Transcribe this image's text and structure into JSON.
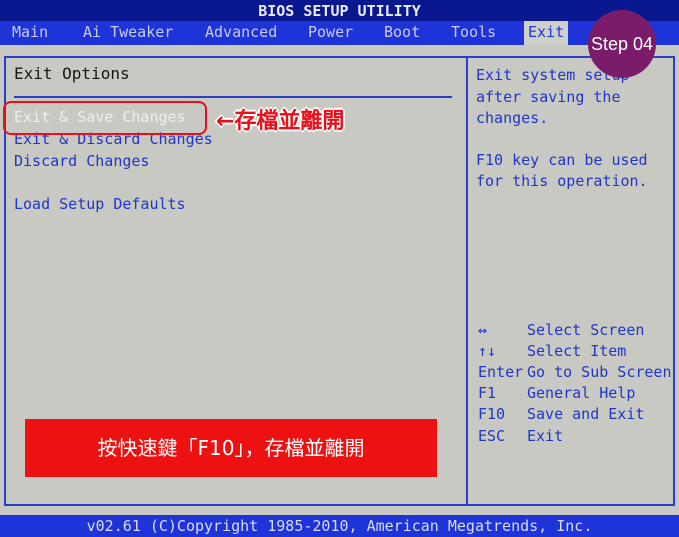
{
  "title": "BIOS SETUP UTILITY",
  "tabs": [
    {
      "label": "Main"
    },
    {
      "label": "Ai Tweaker"
    },
    {
      "label": "Advanced"
    },
    {
      "label": "Power"
    },
    {
      "label": "Boot"
    },
    {
      "label": "Tools"
    },
    {
      "label": "Exit",
      "selected": true
    }
  ],
  "left": {
    "heading": "Exit Options",
    "items": [
      {
        "label": "Exit & Save Changes",
        "highlighted": true
      },
      {
        "label": "Exit & Discard Changes"
      },
      {
        "label": "Discard Changes"
      },
      {
        "label": "Load Setup Defaults"
      }
    ]
  },
  "help": {
    "lines": [
      "Exit system setup",
      "after saving the",
      "changes.",
      "",
      "F10 key can be used",
      "for this operation."
    ]
  },
  "keys": [
    {
      "key": "↔",
      "desc": "Select Screen"
    },
    {
      "key": "↑↓",
      "desc": "Select Item"
    },
    {
      "key": "Enter",
      "desc": "Go to Sub Screen"
    },
    {
      "key": "F1",
      "desc": "General Help"
    },
    {
      "key": "F10",
      "desc": "Save and Exit"
    },
    {
      "key": "ESC",
      "desc": "Exit"
    }
  ],
  "footer": "v02.61 (C)Copyright 1985-2010, American Megatrends, Inc.",
  "annotations": {
    "step": "Step 04",
    "arrow_label": "←存檔並離開",
    "instruction": "按快速鍵「F10」，存檔並離開",
    "step_color": "#7a1c6a",
    "highlight_color": "#ee1111"
  }
}
